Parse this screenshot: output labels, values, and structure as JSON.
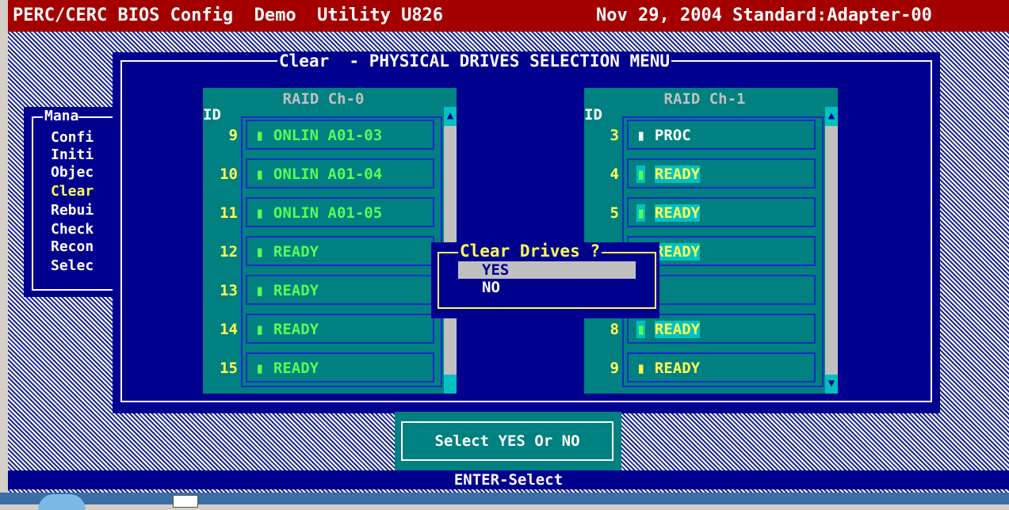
{
  "title_bar": {
    "left_text": "PERC/CERC BIOS Config  Demo  Utility U826",
    "right_text": "Nov 29, 2004 Standard:Adapter-00"
  },
  "management_menu": {
    "title": "Mana",
    "items": [
      {
        "label": "Confi",
        "active": false
      },
      {
        "label": "Initi",
        "active": false
      },
      {
        "label": "Objec",
        "active": false
      },
      {
        "label": "Clear",
        "active": true
      },
      {
        "label": "Rebui",
        "active": false
      },
      {
        "label": "Check",
        "active": false
      },
      {
        "label": "Recon",
        "active": false
      },
      {
        "label": "Selec",
        "active": false
      }
    ]
  },
  "panel": {
    "title": "Clear  - PHYSICAL DRIVES SELECTION MENU"
  },
  "channels": [
    {
      "title": "RAID Ch-0",
      "id_header": "ID",
      "drives": [
        {
          "id": "9",
          "text": "▮ ONLIN A01-03",
          "style": "green"
        },
        {
          "id": "10",
          "text": "▮ ONLIN A01-04",
          "style": "green"
        },
        {
          "id": "11",
          "text": "▮ ONLIN A01-05",
          "style": "green"
        },
        {
          "id": "12",
          "text": "▮ READY",
          "style": "green"
        },
        {
          "id": "13",
          "text": "▮ READY",
          "style": "green"
        },
        {
          "id": "14",
          "text": "▮ READY",
          "style": "green"
        },
        {
          "id": "15",
          "text": "▮ READY",
          "style": "green"
        }
      ]
    },
    {
      "title": "RAID Ch-1",
      "id_header": "ID",
      "drives": [
        {
          "id": "3",
          "text": "▮ PROC",
          "style": "white"
        },
        {
          "id": "4",
          "text": "▮ READY",
          "style": "hl"
        },
        {
          "id": "5",
          "text": "▮ READY",
          "style": "hl"
        },
        {
          "id": "",
          "text": "▮ READY",
          "style": "hl"
        },
        {
          "id": "",
          "text": "",
          "style": "empty"
        },
        {
          "id": "8",
          "text": "▮ READY",
          "style": "hl"
        },
        {
          "id": "9",
          "text": "▮ READY",
          "style": "yellow"
        }
      ]
    }
  ],
  "dialog": {
    "title": "Clear Drives ?",
    "options": [
      {
        "label": "YES",
        "selected": true
      },
      {
        "label": "NO",
        "selected": false
      }
    ]
  },
  "hint": "Select YES Or NO",
  "status_bar": "ENTER-Select",
  "colors": {
    "title_bg": "#a40000",
    "panel_bg": "#00008f",
    "channel_bg": "#008080",
    "ready_text": "#55ff55",
    "selected_text": "#ffff55"
  }
}
